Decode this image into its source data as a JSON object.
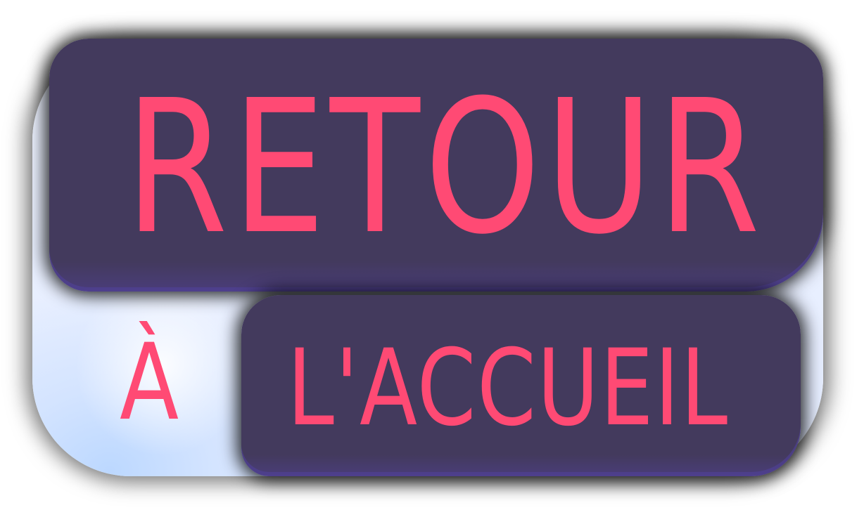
{
  "button": {
    "line1": "RETOUR",
    "line2_prefix": "À",
    "line2_main": "L'ACCUEIL"
  },
  "colors": {
    "text_accent": "#ff4a74",
    "pill_background": "#433a5d",
    "pill_edge": "#4a3d7a",
    "card_background": "#e4ecff",
    "card_glow": "#bcd8ff"
  }
}
